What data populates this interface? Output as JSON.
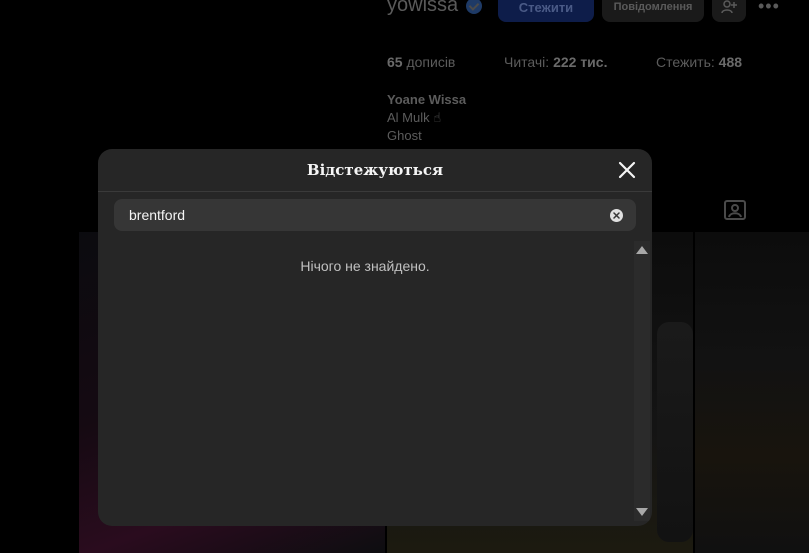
{
  "profile": {
    "username": "yowissa",
    "follow_label": "Стежити",
    "message_label": "Повідомлення",
    "posts_count": "65",
    "posts_label": "дописів",
    "followers_label": "Читачі:",
    "followers_count": "222 тис.",
    "following_label": "Стежить:",
    "following_count": "488",
    "full_name": "Yoane Wissa",
    "bio_line1": "Al Mulk ☝",
    "bio_line2": "Ghost"
  },
  "modal": {
    "title": "Відстежуються",
    "search_value": "brentford",
    "empty_message": "Нічого не знайдено."
  },
  "colors": {
    "modal_bg": "#262626",
    "search_bg": "#363636",
    "page_bg": "#000000"
  },
  "icons": {
    "close": "close-icon",
    "clear": "clear-search-icon",
    "verified": "verified-badge-icon",
    "add_user": "add-user-icon",
    "more": "more-options-icon",
    "tagged": "tagged-posts-icon"
  }
}
